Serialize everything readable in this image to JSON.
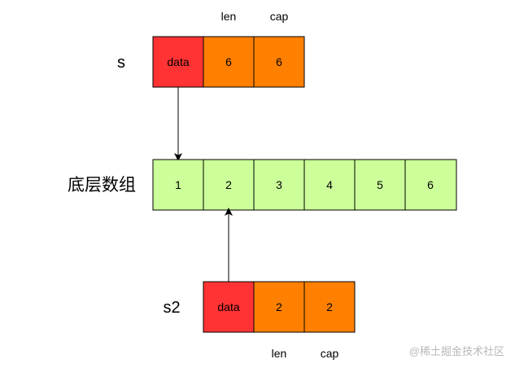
{
  "colors": {
    "data_cell": "#ff3333",
    "len_cap_cell": "#ff8000",
    "array_cell": "#ccff99",
    "stroke": "#000000",
    "watermark": "#b8b8b8"
  },
  "slice_s": {
    "name": "s",
    "header_labels": {
      "len": "len",
      "cap": "cap"
    },
    "cells": {
      "data": "data",
      "len": "6",
      "cap": "6"
    }
  },
  "array": {
    "label": "底层数组",
    "values": [
      "1",
      "2",
      "3",
      "4",
      "5",
      "6"
    ]
  },
  "slice_s2": {
    "name": "s2",
    "footer_labels": {
      "len": "len",
      "cap": "cap"
    },
    "cells": {
      "data": "data",
      "len": "2",
      "cap": "2"
    }
  },
  "watermark": "@稀土掘金技术社区"
}
